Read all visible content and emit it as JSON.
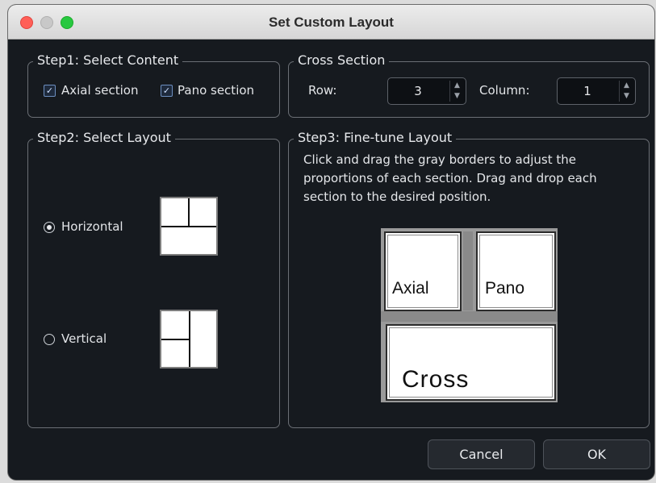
{
  "window": {
    "title": "Set Custom Layout"
  },
  "step1": {
    "legend": "Step1: Select Content",
    "axial_label": "Axial section",
    "axial_checked": true,
    "pano_label": "Pano section",
    "pano_checked": true
  },
  "cross_section": {
    "legend": "Cross Section",
    "row_label": "Row:",
    "row_value": "3",
    "column_label": "Column:",
    "column_value": "1"
  },
  "step2": {
    "legend": "Step2: Select Layout",
    "horizontal_label": "Horizontal",
    "horizontal_selected": true,
    "vertical_label": "Vertical",
    "vertical_selected": false
  },
  "step3": {
    "legend": "Step3: Fine-tune Layout",
    "description": "Click and drag the gray borders to adjust the proportions of each section. Drag and drop each section to the desired position.",
    "panes": {
      "axial": "Axial",
      "pano": "Pano",
      "cross": "Cross"
    }
  },
  "buttons": {
    "cancel": "Cancel",
    "ok": "OK"
  },
  "colors": {
    "close": "#ff5f57",
    "minimize": "#c8c8c8",
    "maximize": "#28c840",
    "background": "#161a1f"
  }
}
